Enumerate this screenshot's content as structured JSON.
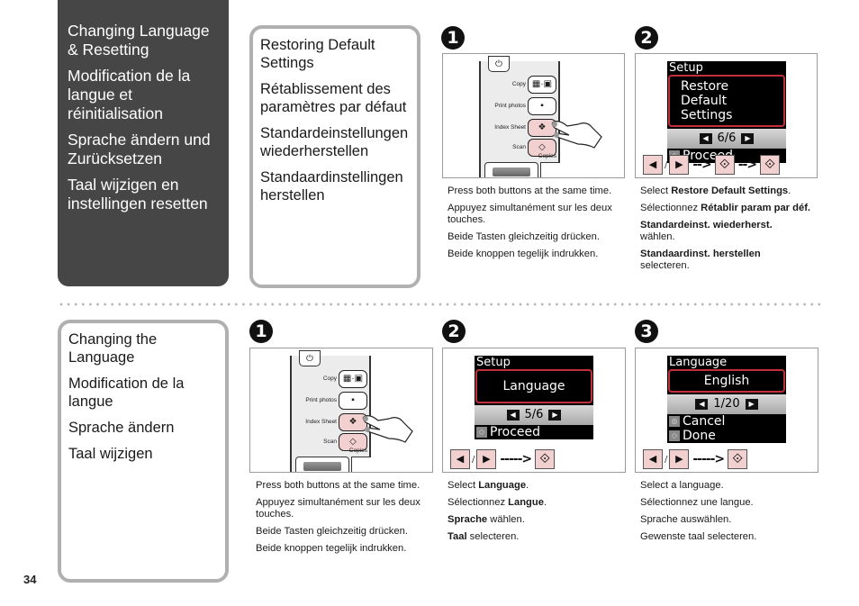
{
  "page_number": "34",
  "section_title": [
    "Changing Language & Resetting",
    "Modification de la langue et réinitialisation",
    "Sprache ändern und Zurücksetzen",
    "Taal wijzigen en instellingen resetten"
  ],
  "restore": {
    "subtitle": [
      "Restoring Default Settings",
      "Rétablissement des paramètres par défaut",
      "Standardeinstellungen wiederherstellen",
      "Standaardinstellingen herstellen"
    ],
    "steps": [
      {
        "number": "1",
        "printer_panel": {
          "labels": [
            "Copy",
            "Print photos",
            "Index Sheet",
            "Scan",
            "Copies"
          ]
        },
        "text": [
          "Press both buttons at the same time.",
          "Appuyez simultanément sur les deux touches.",
          "Beide Tasten gleichzeitig drücken.",
          "Beide knoppen tegelijk indrukken."
        ]
      },
      {
        "number": "2",
        "screen": {
          "header": "Setup",
          "selected": "Restore Default Settings",
          "page": "6/6",
          "actions": [
            "Proceed"
          ]
        },
        "key_sequence": [
          "left",
          "right",
          "start",
          "start"
        ],
        "text": [
          {
            "pre": "Select ",
            "bold": "Restore Default Settings",
            "post": "."
          },
          {
            "pre": "Sélectionnez ",
            "bold": "Rétablir param par déf.",
            "post": ""
          },
          {
            "pre": "",
            "bold": "Standardeinst. wiederherst.",
            "post": " wählen."
          },
          {
            "pre": "",
            "bold": "Standaardinst. herstellen",
            "post": " selecteren."
          }
        ]
      }
    ]
  },
  "language": {
    "subtitle": [
      "Changing the Language",
      "Modification de la langue",
      "Sprache ändern",
      "Taal wijzigen"
    ],
    "steps": [
      {
        "number": "1",
        "printer_panel": {
          "labels": [
            "Copy",
            "Print photos",
            "Index Sheet",
            "Scan",
            "Copies"
          ]
        },
        "text": [
          "Press both buttons at the same time.",
          "Appuyez simultanément sur les deux touches.",
          "Beide Tasten gleichzeitig drücken.",
          "Beide knoppen tegelijk indrukken."
        ]
      },
      {
        "number": "2",
        "screen": {
          "header": "Setup",
          "selected": "Language",
          "page": "5/6",
          "actions": [
            "Proceed"
          ]
        },
        "key_sequence": [
          "left",
          "right",
          "start"
        ],
        "text": [
          {
            "pre": "Select ",
            "bold": "Language",
            "post": "."
          },
          {
            "pre": "Sélectionnez ",
            "bold": "Langue",
            "post": "."
          },
          {
            "pre": "",
            "bold": "Sprache",
            "post": " wählen."
          },
          {
            "pre": "",
            "bold": "Taal",
            "post": " selecteren."
          }
        ]
      },
      {
        "number": "3",
        "screen": {
          "header": "Language",
          "selected": "English",
          "page": "1/20",
          "actions": [
            "Cancel",
            "Done"
          ]
        },
        "key_sequence": [
          "left",
          "right",
          "start"
        ],
        "text": [
          "Select a language.",
          "Sélectionnez une langue.",
          "Sprache auswählen.",
          "Gewenste taal selecteren."
        ]
      }
    ]
  },
  "icons": {
    "left": "◀",
    "right": "▶",
    "start": "⊘",
    "arrow_short": "-->",
    "arrow_long": "----->",
    "slash": "/",
    "power": "⏻",
    "tri_left": "◀",
    "tri_right": "▶"
  },
  "colors": {
    "panel_dark": "#464646",
    "highlight_pink": "#f2d0d0",
    "selection_red": "#c0303a",
    "frame_gray": "#9a9a9a"
  }
}
